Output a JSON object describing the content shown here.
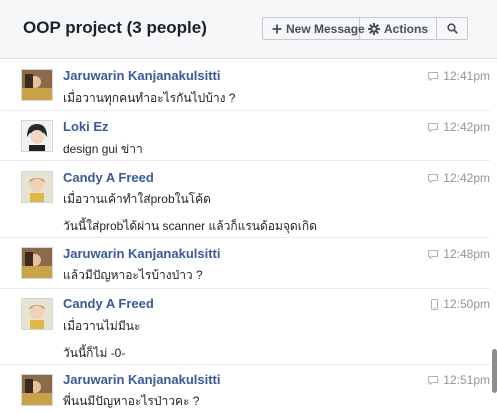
{
  "header": {
    "title": "OOP project (3 people)",
    "new_message_label": "New Message",
    "actions_label": "Actions"
  },
  "icons": {
    "new_message": "plus-icon",
    "actions": "gear-icon",
    "search": "search-icon",
    "chat_source": "chat-bubble-icon",
    "mobile_source": "mobile-phone-icon"
  },
  "colors": {
    "sender_name": "#3b5998",
    "timestamp": "#90949c",
    "header_bg": "#f6f7f9"
  },
  "messages": [
    {
      "sender": "Jaruwarin Kanjanakulsitti",
      "time": "12:41pm",
      "source": "chat",
      "lines": [
        "เมื่อวานทุกคนทำอะไรกันไปบ้าง ?"
      ]
    },
    {
      "sender": "Loki Ez",
      "time": "12:42pm",
      "source": "chat",
      "lines": [
        "design gui ข่าา"
      ]
    },
    {
      "sender": "Candy A Freed",
      "time": "12:42pm",
      "source": "chat",
      "lines": [
        "เมื่อวานเค้าทำใส่probในโค้ด",
        "วันนี้ใส่probได้ผ่าน scanner แล้วก็แรนด้อมจุดเกิด"
      ]
    },
    {
      "sender": "Jaruwarin Kanjanakulsitti",
      "time": "12:48pm",
      "source": "chat",
      "lines": [
        "แล้วมีปัญหาอะไรบ้างป่าว ?"
      ]
    },
    {
      "sender": "Candy A Freed",
      "time": "12:50pm",
      "source": "mobile",
      "lines": [
        "เมื่อวานไม่มีนะ",
        "วันนี้ก็ไม่ -0-"
      ]
    },
    {
      "sender": "Jaruwarin Kanjanakulsitti",
      "time": "12:51pm",
      "source": "chat",
      "lines": [
        "พี่นนมีปัญหาอะไรป่าวคะ ?"
      ]
    }
  ]
}
